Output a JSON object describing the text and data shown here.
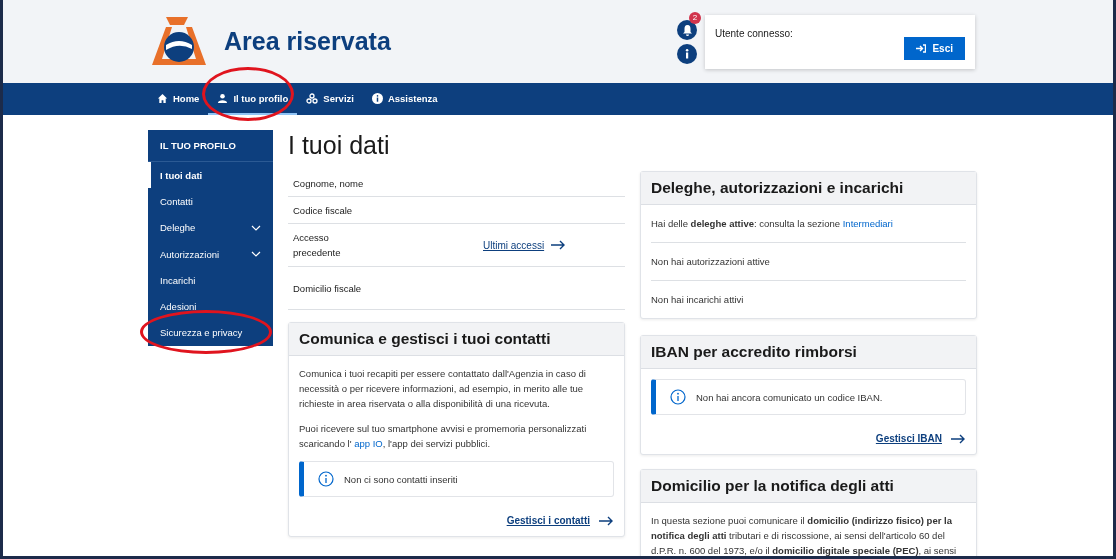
{
  "header": {
    "title": "Area riservata",
    "notifications_badge": "2",
    "user_label": "Utente connesso:",
    "logout_button": "Esci"
  },
  "nav": [
    {
      "kind": "home",
      "label": "Home",
      "selected": false,
      "circled": false
    },
    {
      "kind": "user",
      "label": "Il tuo profilo",
      "selected": true,
      "circled": true
    },
    {
      "kind": "services",
      "label": "Servizi",
      "selected": false,
      "circled": false
    },
    {
      "kind": "info",
      "label": "Assistenza",
      "selected": false,
      "circled": false
    }
  ],
  "sidebar": {
    "title": "IL TUO PROFILO",
    "items": [
      {
        "label": "I tuoi dati",
        "selected": true,
        "expandable": false,
        "circled": false
      },
      {
        "label": "Contatti",
        "selected": false,
        "expandable": false,
        "circled": false
      },
      {
        "label": "Deleghe",
        "selected": false,
        "expandable": true,
        "circled": false
      },
      {
        "label": "Autorizzazioni",
        "selected": false,
        "expandable": true,
        "circled": false
      },
      {
        "label": "Incarichi",
        "selected": false,
        "expandable": false,
        "circled": false
      },
      {
        "label": "Adesioni",
        "selected": false,
        "expandable": false,
        "circled": false
      },
      {
        "label": "Sicurezza e privacy",
        "selected": false,
        "expandable": false,
        "circled": true
      }
    ]
  },
  "page_title": "I tuoi dati",
  "data_rows": [
    {
      "label": "Cognome, nome"
    },
    {
      "label": "Codice fiscale"
    },
    {
      "label": "Accesso precedente",
      "link": "Ultimi accessi"
    },
    {
      "label": "Domicilio fiscale"
    }
  ],
  "contacts_card": {
    "title": "Comunica e gestisci i tuoi contatti",
    "paragraphs": [
      {
        "before": "Comunica i tuoi recapiti per essere contattato dall'Agenzia in caso di necessità o per ricevere informazioni, ad esempio, in merito alle tue richieste in area riservata o alla disponibilità di una ricevuta."
      },
      {
        "before": "Puoi ricevere sul tuo smartphone avvisi e promemoria personalizzati scaricando l' ",
        "link": "app IO",
        "after": ", l'app dei servizi pubblici."
      }
    ],
    "notice": "Non ci sono contatti inseriti",
    "action": "Gestisci i contatti"
  },
  "delegations_card": {
    "title": "Deleghe, autorizzazioni e incarichi",
    "rows": [
      {
        "before": "Hai delle **deleghe attive**: consulta la sezione ",
        "link": "Intermediari"
      },
      {
        "before": "Non hai autorizzazioni attive"
      },
      {
        "before": "Non hai incarichi attivi"
      }
    ]
  },
  "iban_card": {
    "title": "IBAN per accredito rimborsi",
    "notice": "Non hai ancora comunicato un codice IBAN.",
    "action": "Gestisci IBAN"
  },
  "notification_card": {
    "title": "Domicilio per la notifica degli atti",
    "paragraphs": [
      {
        "before": "In questa sezione puoi comunicare il **domicilio (indirizzo fisico) per la notifica degli atti** tributari e di riscossione, ai sensi dell'articolo 60 del d.P.R. n. 600 del 1973, e/o il **domicilio digitale speciale (PEC)**, ai sensi"
      }
    ]
  }
}
